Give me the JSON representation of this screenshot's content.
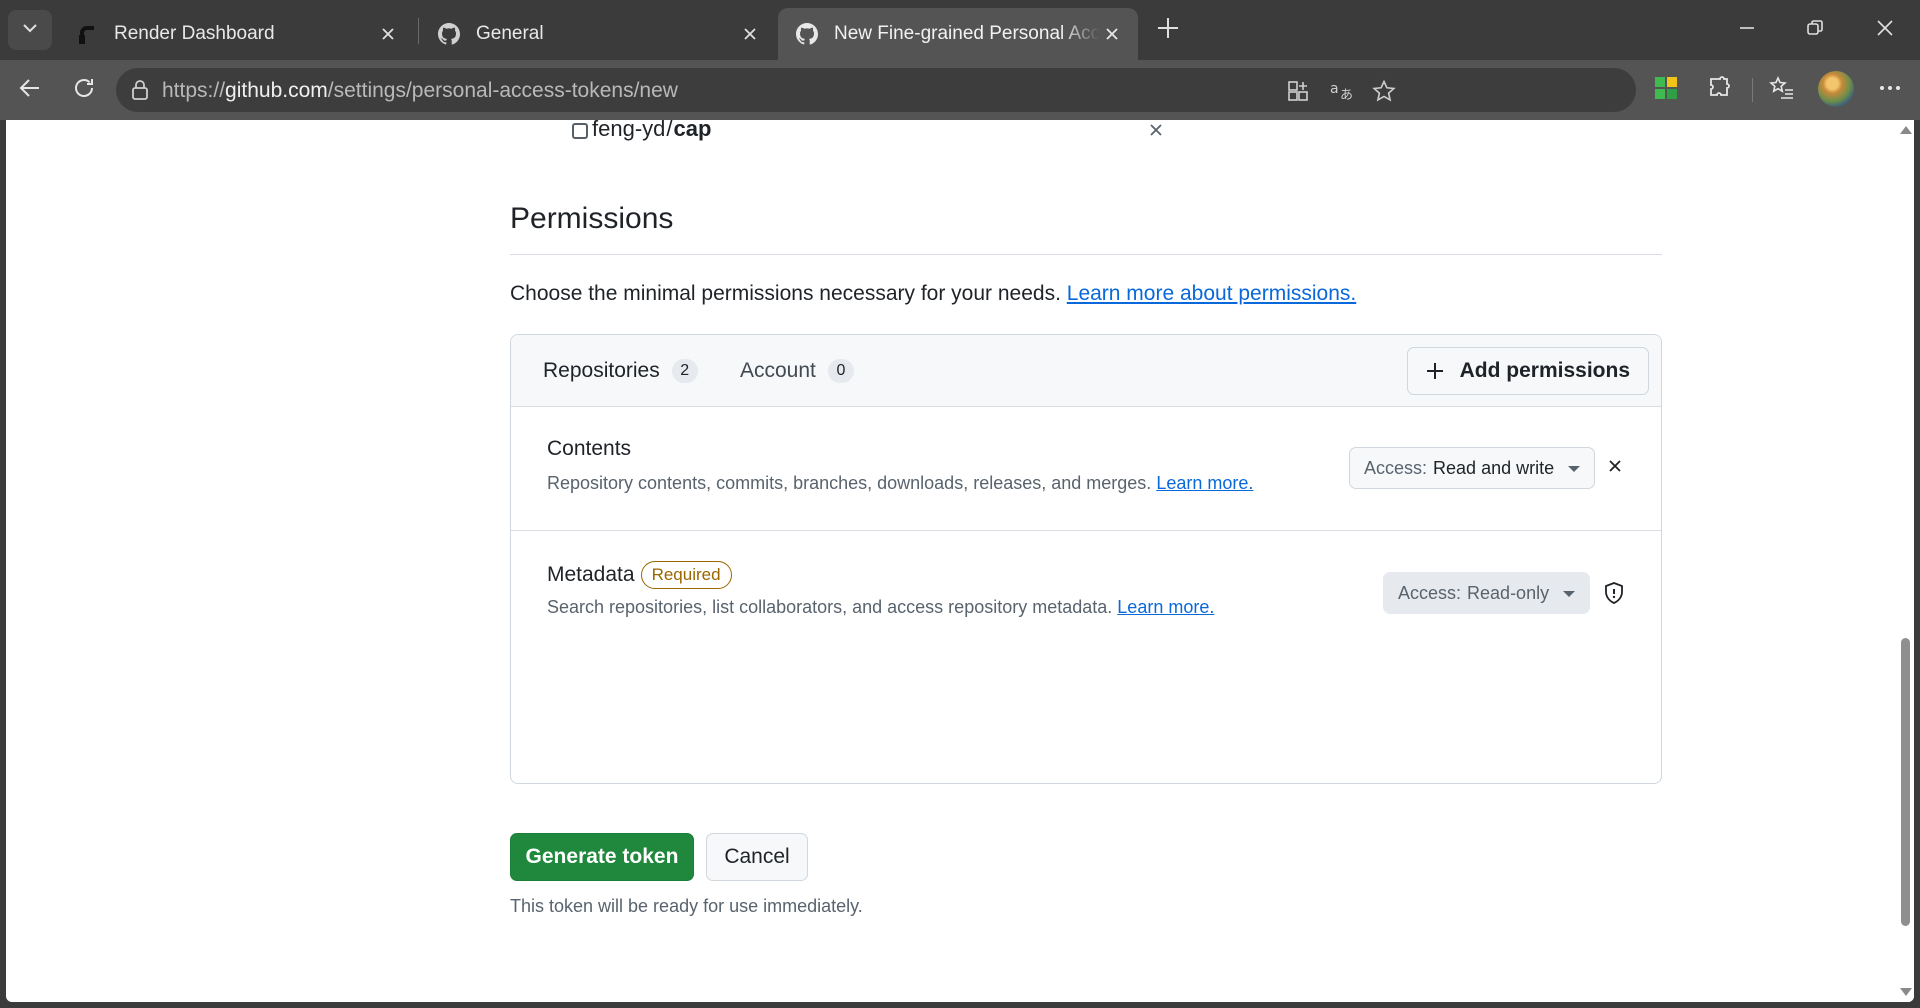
{
  "browser": {
    "tabs": [
      {
        "title": "Render Dashboard",
        "icon": "render-logo-icon"
      },
      {
        "title": "General",
        "icon": "github-icon"
      },
      {
        "title": "New Fine-grained Personal Access Token",
        "icon": "github-icon",
        "active": true
      }
    ],
    "url": {
      "prefix": "https://",
      "host": "github.com",
      "path": "/settings/personal-access-tokens/new"
    }
  },
  "page": {
    "repo": {
      "owner": "feng-yd",
      "separator": "/",
      "name": "cap"
    },
    "permissions": {
      "title": "Permissions",
      "description": "Choose the minimal permissions necessary for your needs.",
      "learn_more": "Learn more about permissions.",
      "tabs": [
        {
          "label": "Repositories",
          "count": "2"
        },
        {
          "label": "Account",
          "count": "0"
        }
      ],
      "add_button": "Add permissions",
      "rows": [
        {
          "name": "Contents",
          "description": "Repository contents, commits, branches, downloads, releases, and merges.",
          "learn_more": "Learn more.",
          "access_prefix": "Access:",
          "access_value": "Read and write"
        },
        {
          "name": "Metadata",
          "badge": "Required",
          "description": "Search repositories, list collaborators, and access repository metadata.",
          "learn_more": "Learn more.",
          "access_prefix": "Access:",
          "access_value": "Read-only"
        }
      ]
    },
    "generate_button": "Generate token",
    "cancel_button": "Cancel",
    "footnote": "This token will be ready for use immediately."
  },
  "colors": {
    "primary_green": "#1f883d",
    "link_blue": "#0969da",
    "attention": "#9a6700"
  }
}
